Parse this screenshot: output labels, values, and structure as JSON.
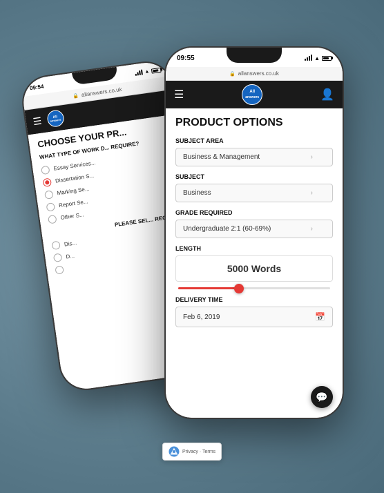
{
  "back_phone": {
    "time": "09:54",
    "url": "allanswers.co.uk",
    "page_title": "CHOOSE YOUR PR...",
    "question1": "WHAT TYPE OF WORK D... REQUIRE?",
    "options": [
      {
        "label": "Essay Services...",
        "selected": false
      },
      {
        "label": "Dissertation S...",
        "selected": true
      },
      {
        "label": "Marking Se...",
        "selected": false
      },
      {
        "label": "Report Se...",
        "selected": false
      },
      {
        "label": "Other S...",
        "selected": false
      }
    ],
    "question2": "PLEASE SEL... REQUIRE:",
    "options2": [
      {
        "label": "Dis..."
      },
      {
        "label": "D..."
      },
      {
        "label": ""
      }
    ]
  },
  "front_phone": {
    "time": "09:55",
    "url": "allanswers.co.uk",
    "page_title": "PRODUCT OPTIONS",
    "fields": {
      "subject_area_label": "SUBJECT AREA",
      "subject_area_value": "Business & Management",
      "subject_label": "SUBJECT",
      "subject_value": "Business",
      "grade_label": "GRADE REQUIRED",
      "grade_value": "Undergraduate 2:1 (60-69%)",
      "length_label": "LENGTH",
      "length_value": "5000 Words",
      "delivery_label": "DELIVERY TIME",
      "delivery_value": "Feb 6, 2019"
    },
    "recaptcha": {
      "text": "Privacy · Terms"
    }
  },
  "logo": {
    "line1": "All",
    "line2": "answers"
  },
  "icons": {
    "hamburger": "☰",
    "user": "👤",
    "lock": "🔒",
    "calendar": "📅",
    "chat": "💬",
    "arrow_down": "›"
  }
}
